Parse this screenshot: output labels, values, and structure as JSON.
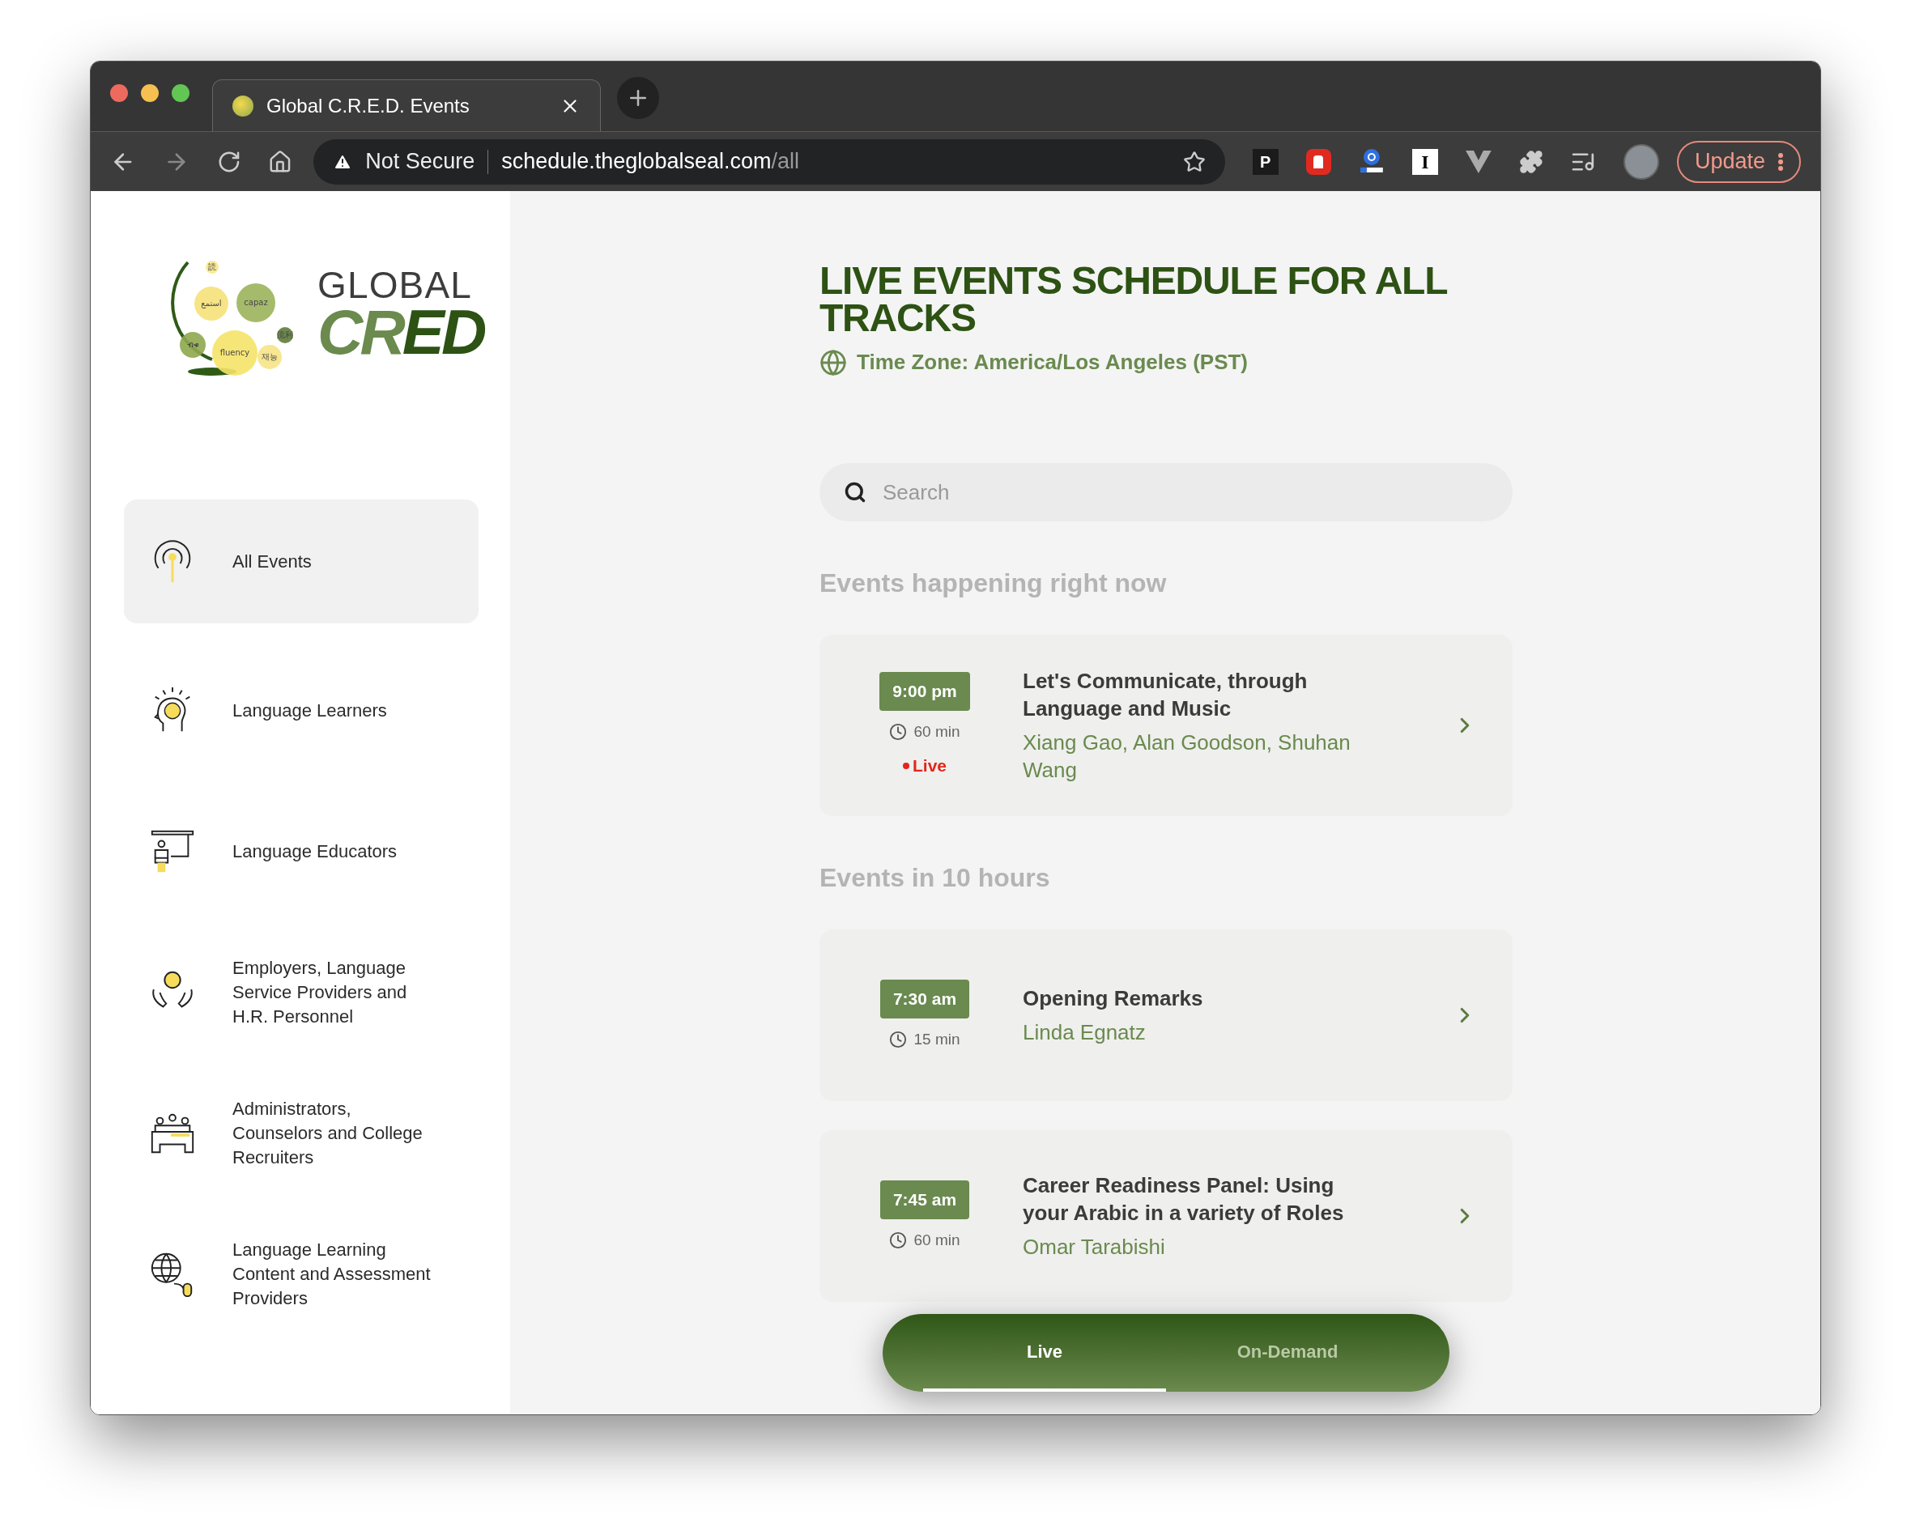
{
  "browser": {
    "tab_title": "Global C.R.E.D. Events",
    "security_label": "Not Secure",
    "url_host": "schedule.theglobalseal.com",
    "url_path": "/all",
    "extension_letters": [
      "P",
      "I"
    ],
    "update_button": "Update"
  },
  "sidebar": {
    "logo": {
      "bubbles": [
        "読",
        "استمع",
        "capaz",
        "ብቁ",
        "流利",
        "fluency",
        "재능"
      ],
      "word_top": "GLOBAL",
      "word_light": "CR",
      "word_dark": "ED"
    },
    "nav": [
      {
        "kind": "broadcast",
        "label": "All Events",
        "selected": true
      },
      {
        "kind": "brain",
        "label": "Language Learners",
        "selected": false
      },
      {
        "kind": "teacher",
        "label": "Language Educators",
        "selected": false
      },
      {
        "kind": "hands",
        "label": "Employers, Language Service Providers and H.R. Personnel",
        "selected": false
      },
      {
        "kind": "panel",
        "label": "Administrators, Counselors and College Recruiters",
        "selected": false
      },
      {
        "kind": "globe",
        "label": "Language Learning Content and Assessment Providers",
        "selected": false
      }
    ]
  },
  "main": {
    "title": "LIVE EVENTS SCHEDULE FOR ALL TRACKS",
    "timezone": "Time Zone: America/Los Angeles (PST)",
    "search": {
      "placeholder": "Search"
    },
    "sections": [
      {
        "heading": "Events happening right now",
        "events": [
          {
            "time": "9:00 pm",
            "duration": "60 min",
            "status": "Live",
            "title": "Let's Communicate, through Language and Music",
            "speakers": "Xiang Gao, Alan Goodson, Shuhan Wang"
          }
        ]
      },
      {
        "heading": "Events in 10 hours",
        "events": [
          {
            "time": "7:30 am",
            "duration": "15 min",
            "title": "Opening Remarks",
            "speakers": "Linda Egnatz"
          },
          {
            "time": "7:45 am",
            "duration": "60 min",
            "title": "Career Readiness Panel: Using your Arabic in a variety of Roles",
            "speakers": "Omar Tarabishi"
          }
        ]
      }
    ],
    "bottom_tabs": [
      {
        "label": "Live",
        "selected": true
      },
      {
        "label": "On-Demand",
        "selected": false
      }
    ]
  }
}
